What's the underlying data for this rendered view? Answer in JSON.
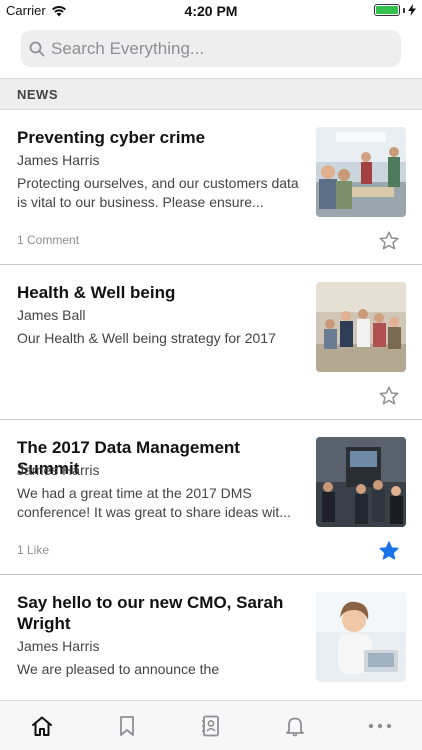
{
  "status_bar": {
    "carrier": "Carrier",
    "time": "4:20 PM"
  },
  "search": {
    "placeholder": "Search Everything..."
  },
  "section": {
    "title": "NEWS"
  },
  "news": [
    {
      "title": "Preventing cyber crime",
      "author": "James Harris",
      "excerpt": "Protecting ourselves, and our customers data is vital to our business. Please ensure...",
      "meta": "1 Comment",
      "favorited": false
    },
    {
      "title": "Health & Well being",
      "author": "James Ball",
      "excerpt": "Our Health & Well being strategy for 2017",
      "meta": "",
      "favorited": false
    },
    {
      "title": "The 2017 Data Management Summit",
      "author": "James Harris",
      "excerpt": "We had a great time at the 2017 DMS conference! It was great to share ideas wit...",
      "meta": "1 Like",
      "favorited": true
    },
    {
      "title": "Say hello to our new CMO, Sarah Wright",
      "author": "James Harris",
      "excerpt": "We are pleased to announce the",
      "meta": "",
      "favorited": false
    }
  ],
  "tabs": [
    {
      "icon": "home-icon",
      "active": true
    },
    {
      "icon": "bookmark-icon",
      "active": false
    },
    {
      "icon": "contacts-icon",
      "active": false
    },
    {
      "icon": "bell-icon",
      "active": false
    },
    {
      "icon": "more-icon",
      "active": false
    }
  ],
  "colors": {
    "accent": "#1a73e8",
    "star_inactive": "#8e8e93",
    "battery": "#32c24d"
  }
}
